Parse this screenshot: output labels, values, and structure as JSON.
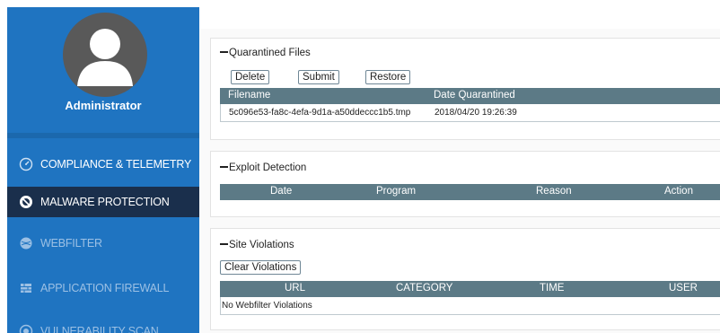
{
  "profile": {
    "name": "Administrator"
  },
  "sidebar": {
    "items": [
      {
        "label": "COMPLIANCE & TELEMETRY",
        "icon": "gauge-icon"
      },
      {
        "label": "MALWARE PROTECTION",
        "icon": "malware-shield-icon",
        "active": true
      },
      {
        "label": "WEBFILTER",
        "icon": "globe-filter-icon"
      },
      {
        "label": "APPLICATION FIREWALL",
        "icon": "firewall-icon"
      },
      {
        "label": "VULNERABILITY SCAN",
        "icon": "scan-icon"
      }
    ]
  },
  "quarantined": {
    "title": "Quarantined Files",
    "buttons": {
      "delete": "Delete",
      "submit": "Submit",
      "restore": "Restore"
    },
    "columns": [
      "Filename",
      "Date Quarantined"
    ],
    "rows": [
      {
        "filename": "5c096e53-fa8c-4efa-9d1a-a50ddeccc1b5.tmp",
        "date": "2018/04/20 19:26:39"
      }
    ]
  },
  "exploit": {
    "title": "Exploit Detection",
    "columns": [
      "Date",
      "Program",
      "Reason",
      "Action"
    ]
  },
  "site_violations": {
    "title": "Site Violations",
    "clear_button": "Clear Violations",
    "columns": [
      "URL",
      "CATEGORY",
      "TIME",
      "USER"
    ],
    "empty_text": "No Webfilter Violations"
  },
  "colors": {
    "sidebar_bg": "#1f74c1",
    "sidebar_active": "#1a2f4c",
    "table_header": "#5c7a86",
    "avatar": "#595959"
  }
}
